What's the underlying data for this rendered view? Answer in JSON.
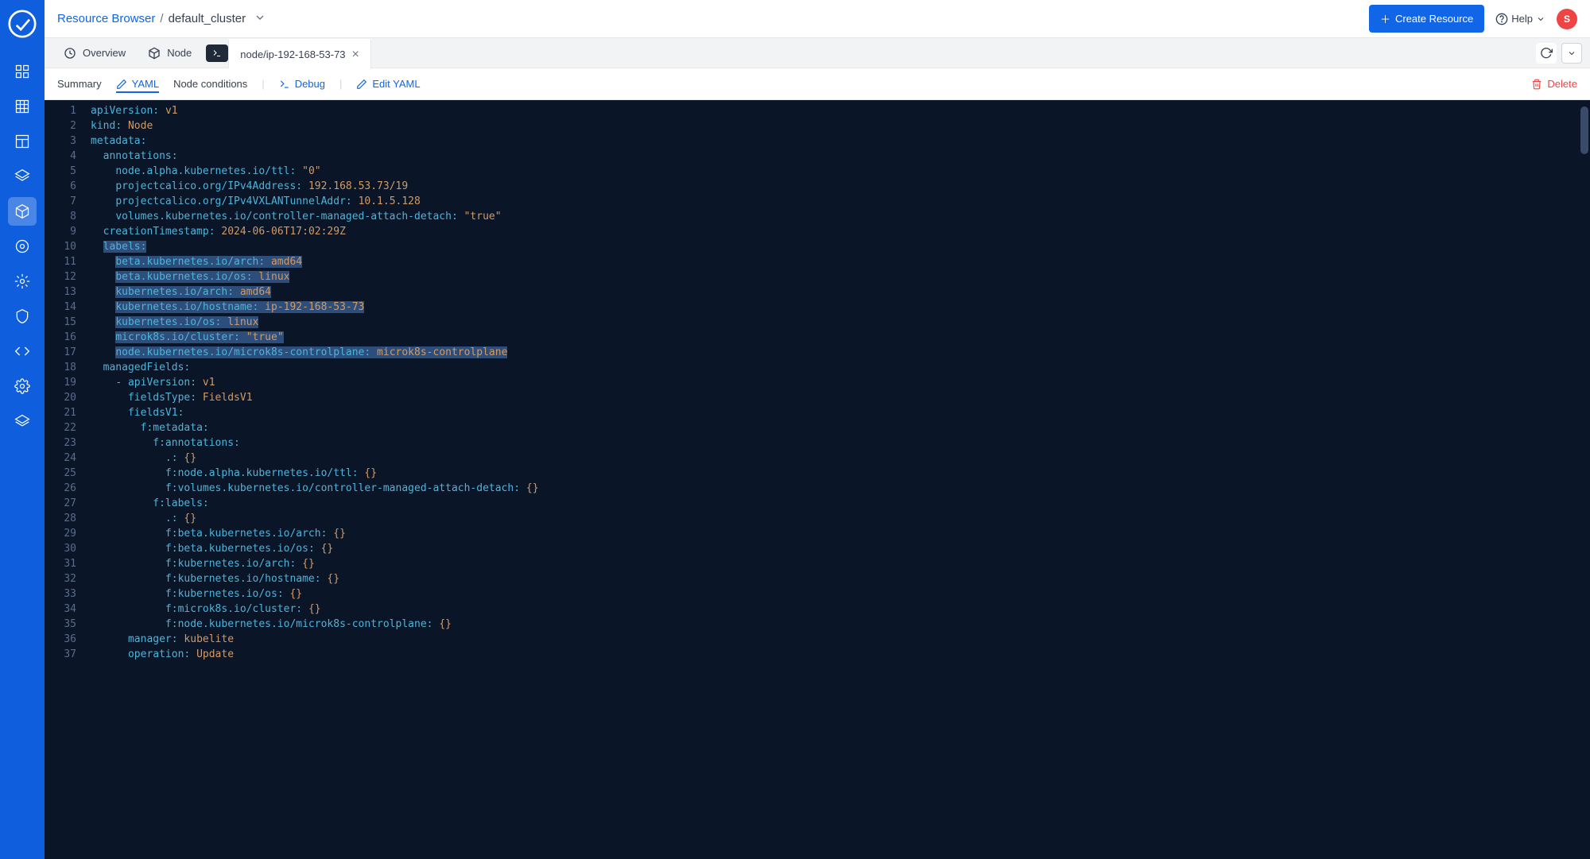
{
  "breadcrumb": {
    "root": "Resource Browser",
    "current": "default_cluster"
  },
  "topbar": {
    "create_label": "Create Resource",
    "help_label": "Help",
    "avatar_letter": "S"
  },
  "tabs": {
    "overview": "Overview",
    "node": "Node",
    "active": "node/ip-192-168-53-73"
  },
  "subtabs": {
    "summary": "Summary",
    "yaml": "YAML",
    "conditions": "Node conditions",
    "debug": "Debug",
    "edit": "Edit YAML",
    "delete": "Delete"
  },
  "code_lines": [
    {
      "n": 1,
      "sel": false,
      "tokens": [
        [
          "k",
          "apiVersion"
        ],
        [
          "p",
          ": "
        ],
        [
          "v",
          "v1"
        ]
      ]
    },
    {
      "n": 2,
      "sel": false,
      "tokens": [
        [
          "k",
          "kind"
        ],
        [
          "p",
          ": "
        ],
        [
          "v",
          "Node"
        ]
      ]
    },
    {
      "n": 3,
      "sel": false,
      "tokens": [
        [
          "k",
          "metadata"
        ],
        [
          "p",
          ":"
        ]
      ]
    },
    {
      "n": 4,
      "sel": false,
      "indent": 1,
      "tokens": [
        [
          "k",
          "annotations"
        ],
        [
          "p",
          ":"
        ]
      ]
    },
    {
      "n": 5,
      "sel": false,
      "indent": 2,
      "tokens": [
        [
          "k",
          "node.alpha.kubernetes.io/ttl"
        ],
        [
          "p",
          ": "
        ],
        [
          "s",
          "\"0\""
        ]
      ]
    },
    {
      "n": 6,
      "sel": false,
      "indent": 2,
      "tokens": [
        [
          "k",
          "projectcalico.org/IPv4Address"
        ],
        [
          "p",
          ": "
        ],
        [
          "v",
          "192.168.53.73/19"
        ]
      ]
    },
    {
      "n": 7,
      "sel": false,
      "indent": 2,
      "tokens": [
        [
          "k",
          "projectcalico.org/IPv4VXLANTunnelAddr"
        ],
        [
          "p",
          ": "
        ],
        [
          "v",
          "10.1.5.128"
        ]
      ]
    },
    {
      "n": 8,
      "sel": false,
      "indent": 2,
      "tokens": [
        [
          "k",
          "volumes.kubernetes.io/controller-managed-attach-detach"
        ],
        [
          "p",
          ": "
        ],
        [
          "s",
          "\"true\""
        ]
      ]
    },
    {
      "n": 9,
      "sel": false,
      "indent": 1,
      "tokens": [
        [
          "k",
          "creationTimestamp"
        ],
        [
          "p",
          ": "
        ],
        [
          "v",
          "2024-06-06T17:02:29Z"
        ]
      ]
    },
    {
      "n": 10,
      "sel": true,
      "indent": 1,
      "tokens": [
        [
          "k",
          "labels"
        ],
        [
          "p",
          ":"
        ]
      ]
    },
    {
      "n": 11,
      "sel": true,
      "indent": 2,
      "tokens": [
        [
          "k",
          "beta.kubernetes.io/arch"
        ],
        [
          "p",
          ": "
        ],
        [
          "v",
          "amd64"
        ]
      ]
    },
    {
      "n": 12,
      "sel": true,
      "indent": 2,
      "tokens": [
        [
          "k",
          "beta.kubernetes.io/os"
        ],
        [
          "p",
          ": "
        ],
        [
          "v",
          "linux"
        ]
      ]
    },
    {
      "n": 13,
      "sel": true,
      "indent": 2,
      "tokens": [
        [
          "k",
          "kubernetes.io/arch"
        ],
        [
          "p",
          ": "
        ],
        [
          "v",
          "amd64"
        ]
      ]
    },
    {
      "n": 14,
      "sel": true,
      "indent": 2,
      "tokens": [
        [
          "k",
          "kubernetes.io/hostname"
        ],
        [
          "p",
          ": "
        ],
        [
          "v",
          "ip-192-168-53-73"
        ]
      ]
    },
    {
      "n": 15,
      "sel": true,
      "indent": 2,
      "tokens": [
        [
          "k",
          "kubernetes.io/os"
        ],
        [
          "p",
          ": "
        ],
        [
          "v",
          "linux"
        ]
      ]
    },
    {
      "n": 16,
      "sel": true,
      "indent": 2,
      "tokens": [
        [
          "k",
          "microk8s.io/cluster"
        ],
        [
          "p",
          ": "
        ],
        [
          "s",
          "\"true\""
        ]
      ]
    },
    {
      "n": 17,
      "sel": true,
      "indent": 2,
      "tokens": [
        [
          "k",
          "node.kubernetes.io/microk8s-controlplane"
        ],
        [
          "p",
          ": "
        ],
        [
          "v",
          "microk8s-controlplane"
        ]
      ]
    },
    {
      "n": 18,
      "sel": false,
      "indent": 1,
      "tokens": [
        [
          "k",
          "managedFields"
        ],
        [
          "p",
          ":"
        ]
      ]
    },
    {
      "n": 19,
      "sel": false,
      "indent": 2,
      "tokens": [
        [
          "p",
          "- "
        ],
        [
          "k",
          "apiVersion"
        ],
        [
          "p",
          ": "
        ],
        [
          "v",
          "v1"
        ]
      ]
    },
    {
      "n": 20,
      "sel": false,
      "indent": 3,
      "tokens": [
        [
          "k",
          "fieldsType"
        ],
        [
          "p",
          ": "
        ],
        [
          "v",
          "FieldsV1"
        ]
      ]
    },
    {
      "n": 21,
      "sel": false,
      "indent": 3,
      "tokens": [
        [
          "k",
          "fieldsV1"
        ],
        [
          "p",
          ":"
        ]
      ]
    },
    {
      "n": 22,
      "sel": false,
      "indent": 4,
      "tokens": [
        [
          "k",
          "f:metadata"
        ],
        [
          "p",
          ":"
        ]
      ]
    },
    {
      "n": 23,
      "sel": false,
      "indent": 5,
      "tokens": [
        [
          "k",
          "f:annotations"
        ],
        [
          "p",
          ":"
        ]
      ]
    },
    {
      "n": 24,
      "sel": false,
      "indent": 6,
      "tokens": [
        [
          "k",
          "."
        ],
        [
          "p",
          ": "
        ],
        [
          "v",
          "{}"
        ]
      ]
    },
    {
      "n": 25,
      "sel": false,
      "indent": 6,
      "tokens": [
        [
          "k",
          "f:node.alpha.kubernetes.io/ttl"
        ],
        [
          "p",
          ": "
        ],
        [
          "v",
          "{}"
        ]
      ]
    },
    {
      "n": 26,
      "sel": false,
      "indent": 6,
      "tokens": [
        [
          "k",
          "f:volumes.kubernetes.io/controller-managed-attach-detach"
        ],
        [
          "p",
          ": "
        ],
        [
          "v",
          "{}"
        ]
      ]
    },
    {
      "n": 27,
      "sel": false,
      "indent": 5,
      "tokens": [
        [
          "k",
          "f:labels"
        ],
        [
          "p",
          ":"
        ]
      ]
    },
    {
      "n": 28,
      "sel": false,
      "indent": 6,
      "tokens": [
        [
          "k",
          "."
        ],
        [
          "p",
          ": "
        ],
        [
          "v",
          "{}"
        ]
      ]
    },
    {
      "n": 29,
      "sel": false,
      "indent": 6,
      "tokens": [
        [
          "k",
          "f:beta.kubernetes.io/arch"
        ],
        [
          "p",
          ": "
        ],
        [
          "v",
          "{}"
        ]
      ]
    },
    {
      "n": 30,
      "sel": false,
      "indent": 6,
      "tokens": [
        [
          "k",
          "f:beta.kubernetes.io/os"
        ],
        [
          "p",
          ": "
        ],
        [
          "v",
          "{}"
        ]
      ]
    },
    {
      "n": 31,
      "sel": false,
      "indent": 6,
      "tokens": [
        [
          "k",
          "f:kubernetes.io/arch"
        ],
        [
          "p",
          ": "
        ],
        [
          "v",
          "{}"
        ]
      ]
    },
    {
      "n": 32,
      "sel": false,
      "indent": 6,
      "tokens": [
        [
          "k",
          "f:kubernetes.io/hostname"
        ],
        [
          "p",
          ": "
        ],
        [
          "v",
          "{}"
        ]
      ]
    },
    {
      "n": 33,
      "sel": false,
      "indent": 6,
      "tokens": [
        [
          "k",
          "f:kubernetes.io/os"
        ],
        [
          "p",
          ": "
        ],
        [
          "v",
          "{}"
        ]
      ]
    },
    {
      "n": 34,
      "sel": false,
      "indent": 6,
      "tokens": [
        [
          "k",
          "f:microk8s.io/cluster"
        ],
        [
          "p",
          ": "
        ],
        [
          "v",
          "{}"
        ]
      ]
    },
    {
      "n": 35,
      "sel": false,
      "indent": 6,
      "tokens": [
        [
          "k",
          "f:node.kubernetes.io/microk8s-controlplane"
        ],
        [
          "p",
          ": "
        ],
        [
          "v",
          "{}"
        ]
      ]
    },
    {
      "n": 36,
      "sel": false,
      "indent": 3,
      "tokens": [
        [
          "k",
          "manager"
        ],
        [
          "p",
          ": "
        ],
        [
          "v",
          "kubelite"
        ]
      ]
    },
    {
      "n": 37,
      "sel": false,
      "indent": 3,
      "tokens": [
        [
          "k",
          "operation"
        ],
        [
          "p",
          ": "
        ],
        [
          "v",
          "Update"
        ]
      ]
    }
  ]
}
